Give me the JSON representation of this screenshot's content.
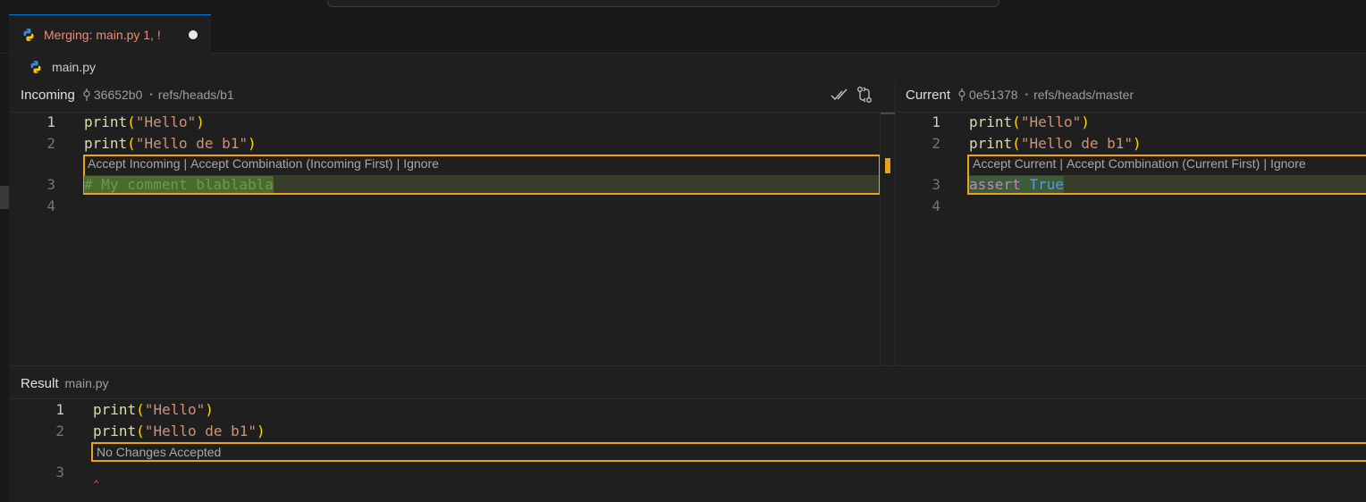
{
  "tab": {
    "title": "Merging: main.py 1, !",
    "icon": "python-icon"
  },
  "breadcrumb": {
    "file": "main.py"
  },
  "incoming": {
    "title": "Incoming",
    "commit": "36652b0",
    "ref": "refs/heads/b1",
    "codelens": {
      "accept": "Accept Incoming",
      "combination": "Accept Combination (Incoming First)",
      "ignore": "Ignore",
      "separator": "|"
    },
    "lines": [
      {
        "no": "1",
        "fn": "print",
        "open": "(",
        "str": "\"Hello\"",
        "close": ")"
      },
      {
        "no": "2",
        "fn": "print",
        "open": "(",
        "str": "\"Hello de b1\"",
        "close": ")"
      }
    ],
    "line3_no": "3",
    "line3_text": "# My comment blablabla",
    "line4_no": "4"
  },
  "current": {
    "title": "Current",
    "commit": "0e51378",
    "ref": "refs/heads/master",
    "codelens": {
      "accept": "Accept Current",
      "combination": "Accept Combination (Current First)",
      "ignore": "Ignore",
      "separator": "|"
    },
    "lines": [
      {
        "no": "1",
        "fn": "print",
        "open": "(",
        "str": "\"Hello\"",
        "close": ")"
      },
      {
        "no": "2",
        "fn": "print",
        "open": "(",
        "str": "\"Hello de b1\"",
        "close": ")"
      }
    ],
    "line3_no": "3",
    "line3_kw": "assert",
    "line3_const": "True",
    "line4_no": "4"
  },
  "result": {
    "title": "Result",
    "file": "main.py",
    "lines": [
      {
        "no": "1",
        "fn": "print",
        "open": "(",
        "str": "\"Hello\"",
        "close": ")"
      },
      {
        "no": "2",
        "fn": "print",
        "open": "(",
        "str": "\"Hello de b1\"",
        "close": ")"
      }
    ],
    "codelens": "No Changes Accepted",
    "line3_no": "3"
  },
  "colors": {
    "conflict_border": "#e8a317",
    "tab_title": "#f48771",
    "accent": "#0078d4"
  }
}
